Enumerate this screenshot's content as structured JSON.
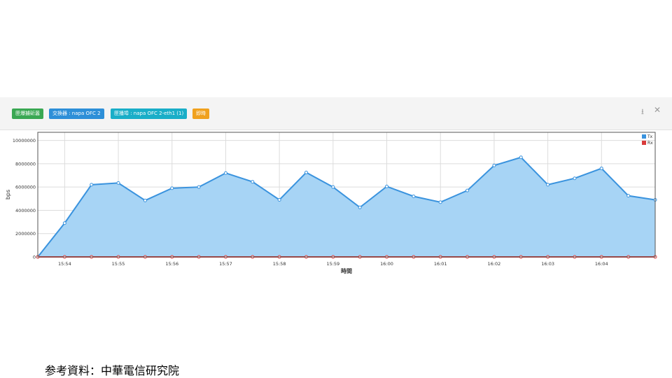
{
  "toolbar": {
    "tags": [
      "匣爆擄斫嚣",
      "交換器 : napa OFC 2",
      "匣播埠 : napa OFC 2-eth1 (1)",
      "即時"
    ],
    "download_icon": "download-icon",
    "close_icon": "close-icon"
  },
  "colors": {
    "tx": "#3a93de",
    "tx_fill": "#a7d4f5",
    "rx": "#d93b3b"
  },
  "source_text": "参考資料：中華電信研究院",
  "chart_data": {
    "type": "area",
    "x": [
      "15:53:30",
      "15:54",
      "15:54:30",
      "15:55",
      "15:55:30",
      "15:56",
      "15:56:30",
      "15:57",
      "15:57:30",
      "15:58",
      "15:58:30",
      "15:59",
      "15:59:30",
      "16:00",
      "16:00:30",
      "16:01",
      "16:01:30",
      "16:02",
      "16:02:30",
      "16:03",
      "16:03:30",
      "16:04",
      "16:04:30",
      "16:05"
    ],
    "series": [
      {
        "name": "Tx",
        "values": [
          0,
          2900000,
          6200000,
          6350000,
          4850000,
          5900000,
          6000000,
          7200000,
          6450000,
          4900000,
          7250000,
          6000000,
          4250000,
          6050000,
          5200000,
          4700000,
          5700000,
          7850000,
          8550000,
          6200000,
          6750000,
          7600000,
          5250000,
          4900000
        ]
      },
      {
        "name": "Rx",
        "values": [
          0,
          0,
          0,
          0,
          0,
          0,
          0,
          0,
          0,
          0,
          0,
          0,
          0,
          0,
          0,
          0,
          0,
          0,
          0,
          0,
          0,
          0,
          0,
          0
        ]
      }
    ],
    "xticks": [
      "15:54",
      "15:55",
      "15:56",
      "15:57",
      "15:58",
      "15:59",
      "16:00",
      "16:01",
      "16:02",
      "16:03",
      "16:04"
    ],
    "yticks": [
      "0",
      "2000000",
      "4000000",
      "6000000",
      "8000000",
      "10000000"
    ],
    "ylim": [
      0,
      10700000
    ],
    "xlabel": "時間",
    "ylabel": "bps",
    "legend": "top-right",
    "grid": true
  }
}
